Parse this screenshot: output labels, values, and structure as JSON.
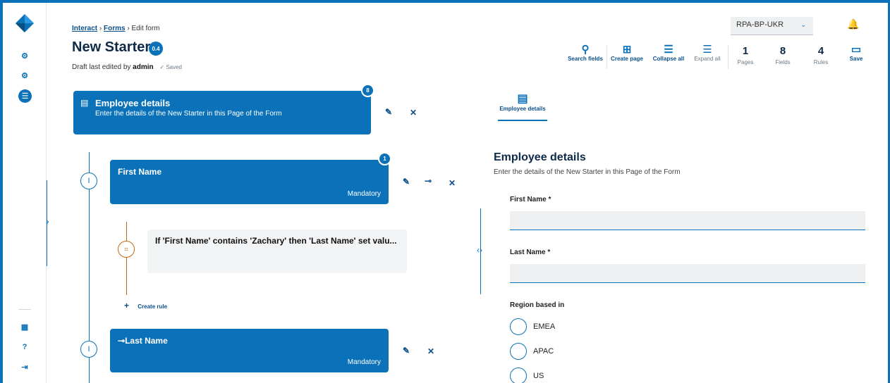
{
  "header": {
    "breadcrumb": {
      "interact": "Interact",
      "sep": "›",
      "forms": "Forms",
      "current": "Edit form"
    },
    "title": "New Starter",
    "version": "0.4",
    "draft_prefix": "Draft last edited by",
    "draft_user": "admin",
    "saved": "✓ Saved"
  },
  "environment": {
    "selected": "RPA-BP-UKR"
  },
  "toolbar": {
    "search": "Search fields",
    "create_page": "Create page",
    "collapse_all": "Collapse all",
    "expand_all": "Expand all",
    "stats": [
      {
        "value": "1",
        "label": "Pages"
      },
      {
        "value": "8",
        "label": "Fields"
      },
      {
        "value": "4",
        "label": "Rules"
      }
    ],
    "save": "Save"
  },
  "page": {
    "title": "Employee details",
    "subtitle": "Enter the details of the New Starter in this Page of the Form",
    "field_count": "8"
  },
  "fields": [
    {
      "name": "First Name",
      "status": "Mandatory",
      "rule_count": "1"
    },
    {
      "name": "Last Name",
      "status": "Mandatory"
    }
  ],
  "rule": {
    "text": "If 'First Name' contains 'Zachary' then 'Last Name' set valu...",
    "create": "Create rule"
  },
  "preview": {
    "tab": "Employee details",
    "title": "Employee details",
    "subtitle": "Enter the details of the New Starter in this Page of the Form",
    "first_name_label": "First Name *",
    "last_name_label": "Last Name *",
    "region_label": "Region based in",
    "regions": [
      "EMEA",
      "APAC",
      "US"
    ]
  },
  "colors": {
    "accent": "#0b72b9",
    "rule": "#c56a10"
  }
}
